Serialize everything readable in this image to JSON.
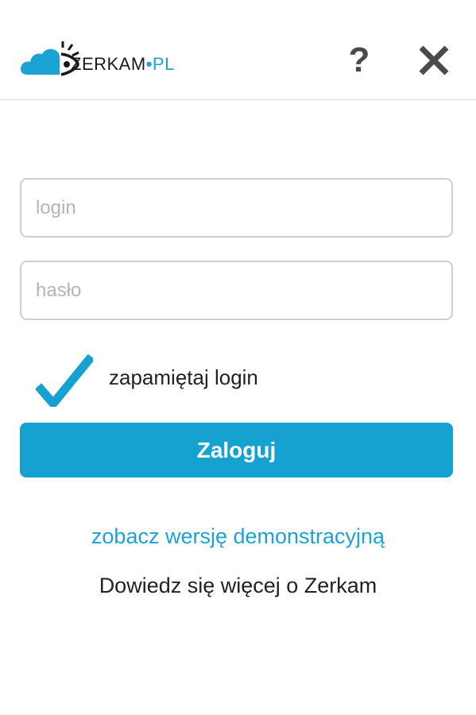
{
  "header": {
    "logo": {
      "brand": "ZERKAM",
      "separator": "•",
      "tld": "PL",
      "accent_color": "#1aa3d3"
    },
    "help_label": "?",
    "help_icon": "question-mark-icon",
    "close_icon": "close-icon"
  },
  "form": {
    "login": {
      "placeholder": "login",
      "value": ""
    },
    "password": {
      "placeholder": "hasło",
      "value": ""
    },
    "remember": {
      "label": "zapamiętaj login",
      "checked": true,
      "check_icon": "checkmark-icon"
    },
    "submit_label": "Zaloguj"
  },
  "links": {
    "demo": "zobacz wersję demonstracyjną",
    "about": "Dowiedz się więcej o Zerkam"
  },
  "colors": {
    "primary": "#16a2d0",
    "close_icon": "#4a4a4a"
  }
}
